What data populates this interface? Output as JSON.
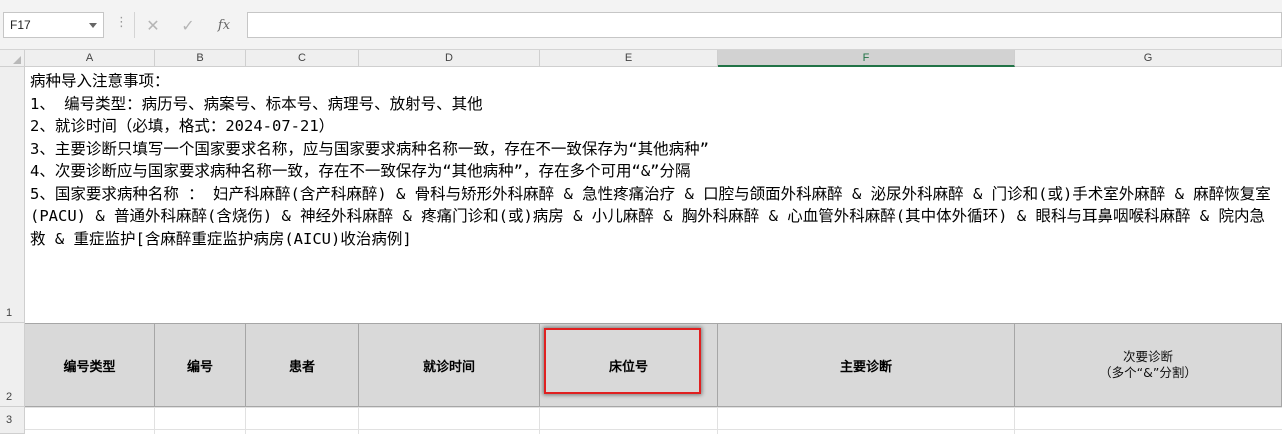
{
  "formula_bar": {
    "cell_ref": "F17",
    "fx_label": "fx",
    "formula_value": ""
  },
  "columns": [
    "A",
    "B",
    "C",
    "D",
    "E",
    "F",
    "G"
  ],
  "rows": [
    "1",
    "2",
    "3"
  ],
  "notes": {
    "line1": "病种导入注意事项：",
    "line2": "1、  编号类型：病历号、病案号、标本号、病理号、放射号、其他",
    "line3": "2、就诊时间（必填，格式：2024-07-21）",
    "line4": "3、主要诊断只填写一个国家要求名称，应与国家要求病种名称一致，存在不一致保存为“其他病种”",
    "line5": "4、次要诊断应与国家要求病种名称一致，存在不一致保存为“其他病种”，存在多个可用“&”分隔",
    "line6": "5、国家要求病种名称 ： 妇产科麻醉(含产科麻醉) & 骨科与矫形外科麻醉 & 急性疼痛治疗 & 口腔与颌面外科麻醉 & 泌尿外科麻醉 & 门诊和(或)手术室外麻醉 & 麻醉恢复室(PACU) & 普通外科麻醉(含烧伤) & 神经外科麻醉 & 疼痛门诊和(或)病房 & 小儿麻醉 & 胸外科麻醉 & 心血管外科麻醉(其中体外循环) & 眼科与耳鼻咽喉科麻醉 & 院内急救 & 重症监护[含麻醉重症监护病房(AICU)收治病例]"
  },
  "header_row": {
    "a": "编号类型",
    "b": "编号",
    "c": "患者",
    "d": "就诊时间",
    "e": "床位号",
    "f": "主要诊断",
    "g_line1": "次要诊断",
    "g_line2": "（多个“&”分割）"
  },
  "colors": {
    "header_fill": "#d9d9d9",
    "highlight_border": "#e02020",
    "selected_column_accent": "#217346"
  }
}
